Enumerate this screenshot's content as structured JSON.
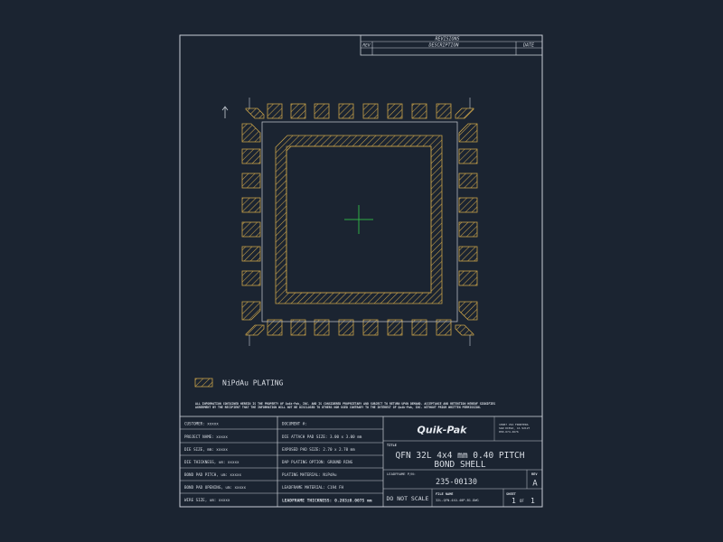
{
  "revisions": {
    "title": "REVISIONS",
    "col_rev": "REV",
    "col_description": "DESCRIPTION",
    "col_date": "DATE"
  },
  "legend": {
    "label": "NiPdAu PLATING"
  },
  "notice": {
    "line1": "ALL INFORMATION CONTAINED HEREIN IS THE PROPERTY OF Quik-Pak, INC. AND IS CONSIDERED PROPRIETARY AND SUBJECT TO RETURN UPON DEMAND. ACCEPTANCE AND RETENTION HEREOF SIGNIFIES",
    "line2": "AGREEMENT BY THE RECIPIENT THAT THE INFORMATION WILL NOT BE DISCLOSED TO OTHERS NOR USED CONTRARY TO THE INTEREST OF Quik-Pak, INC. WITHOUT PRIOR WRITTEN PERMISSION."
  },
  "left_block": {
    "customer": "CUSTOMER:  xxxxx",
    "project_name": "PROJECT NAME:  xxxxx",
    "die_size": "DIE SIZE, mm: xxxxx",
    "die_thickness": "DIE THICKNESS, um: xxxxx",
    "bond_pad_pitch": "BOND PAD PITCH, um: xxxxx",
    "bond_pad_opening": "BOND PAD OPENING, um:  xxxxx",
    "wire_size": "WIRE SIZE, um:  xxxxx"
  },
  "mid_block": {
    "document": "DOCUMENT #:",
    "die_attach_pad": "DIE ATTACH PAD SIZE:  3.00 x 3.00 mm",
    "exposed_pad": "EXPOSED PAD SIZE:  2.70 x 2.70 mm",
    "dap_plating": "DAP PLATING OPTION:  GROUND RING",
    "plating_material": "PLATING MATERIAL:  NiPdAu",
    "leadframe_material": "LEADFRAME MATERIAL:  C194 FH",
    "leadframe_thickness": "LEADFRAME THICKNESS: 0.203±0.0075 mm"
  },
  "right_block": {
    "logo": "Quik-Pak",
    "address1": "10987 VIA FRONTERA",
    "address2": "SAN DIEGO, CA 92127",
    "address3": "858-674-4676",
    "title_label": "TITLE",
    "title_line1": "QFN 32L 4x4 mm 0.40 PITCH",
    "title_line2": "BOND SHELL",
    "pn_label": "LEADFRAME P/N:",
    "pn_value": "235-00130",
    "rev_label": "REV",
    "rev_value": "A",
    "do_not_scale": "DO NOT SCALE",
    "file_label": "FILE NAME",
    "file_value": "32L-QFN-4X4-40P-B1.DWG",
    "sheet_label": "SHEET",
    "sheet_num": "1",
    "sheet_of": "OF",
    "sheet_total": "1"
  },
  "colors": {
    "background": "#1b2431",
    "line": "#c9ced6",
    "hatch": "#c9a24a",
    "crosshair": "#2fae45",
    "logo": "#c0392b"
  }
}
